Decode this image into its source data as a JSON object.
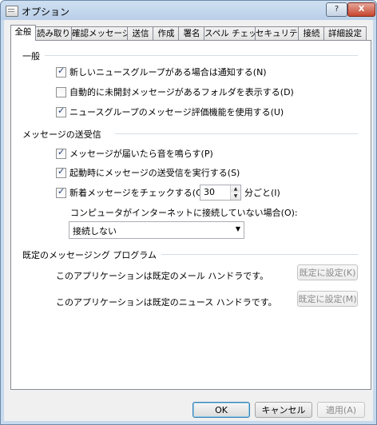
{
  "window": {
    "title": "オプション",
    "help_label": "?",
    "close_label": "X"
  },
  "tabs": [
    {
      "label": "全般",
      "active": true
    },
    {
      "label": "読み取り"
    },
    {
      "label": "確認メッセージ"
    },
    {
      "label": "送信"
    },
    {
      "label": "作成"
    },
    {
      "label": "署名"
    },
    {
      "label": "スペル チェック"
    },
    {
      "label": "セキュリティ"
    },
    {
      "label": "接続"
    },
    {
      "label": "詳細設定"
    }
  ],
  "general": {
    "heading": "一般",
    "options": [
      {
        "label": "新しいニュースグループがある場合は通知する(N)",
        "checked": true
      },
      {
        "label": "自動的に未開封メッセージがあるフォルダを表示する(D)",
        "checked": false
      },
      {
        "label": "ニュースグループのメッセージ評価機能を使用する(U)",
        "checked": true
      }
    ]
  },
  "send_receive": {
    "heading": "メッセージの送受信",
    "options": [
      {
        "label": "メッセージが届いたら音を鳴らす(P)",
        "checked": true
      },
      {
        "label": "起動時にメッセージの送受信を実行する(S)",
        "checked": true
      },
      {
        "label": "新着メッセージをチェックする(C)",
        "checked": true
      }
    ],
    "interval_value": "30",
    "interval_unit": "分ごと(I)",
    "offline_label": "コンピュータがインターネットに接続していない場合(O):",
    "offline_value": "接続しない"
  },
  "default_programs": {
    "heading": "既定のメッセージング プログラム",
    "mail_text": "このアプリケーションは既定のメール ハンドラです。",
    "mail_button": "既定に設定(K)",
    "news_text": "このアプリケーションは既定のニュース ハンドラです。",
    "news_button": "既定に設定(M)"
  },
  "footer": {
    "ok": "OK",
    "cancel": "キャンセル",
    "apply": "適用(A)"
  }
}
